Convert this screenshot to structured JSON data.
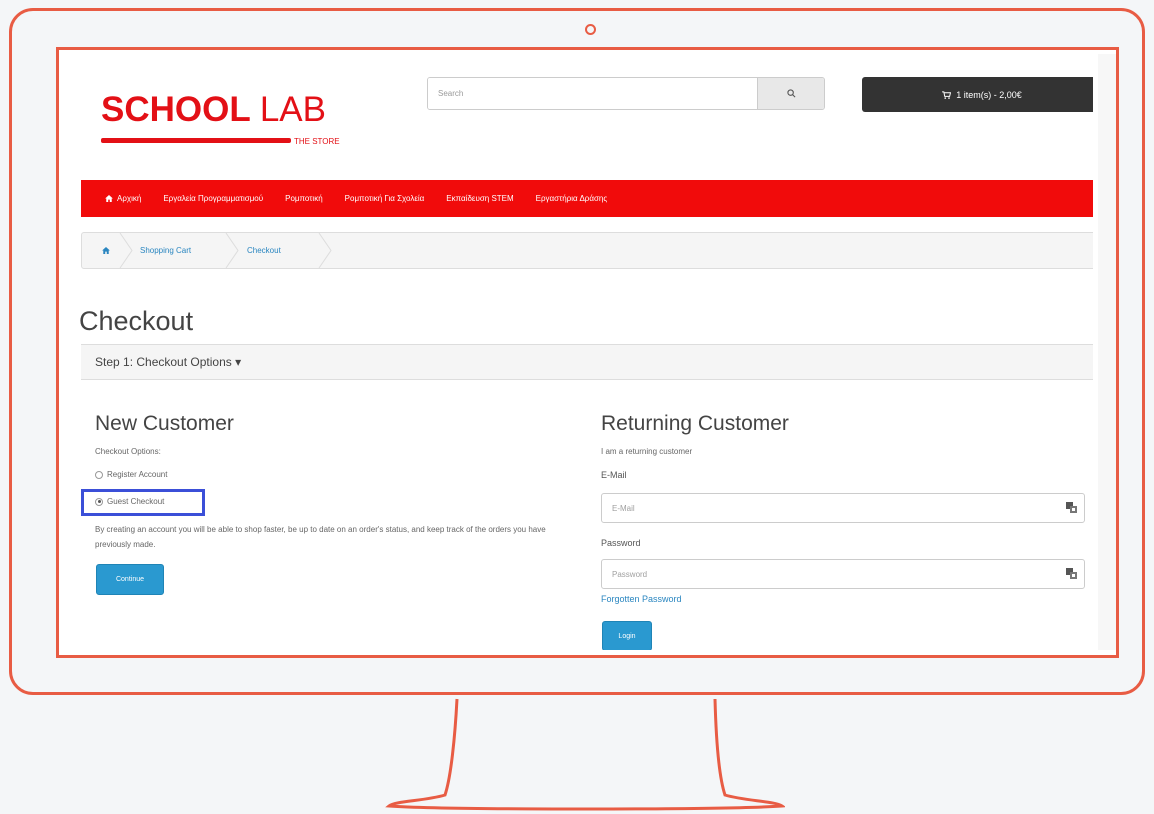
{
  "header": {
    "logo_bold": "SCHOOL",
    "logo_thin": "LAB",
    "logo_sub": "THE STORE",
    "search_placeholder": "Search",
    "cart_label": "1 item(s) - 2,00€"
  },
  "nav": {
    "items": [
      {
        "label": "Αρχική",
        "icon": "home-icon"
      },
      {
        "label": "Εργαλεία Προγραμματισμού"
      },
      {
        "label": "Ρομποτική"
      },
      {
        "label": "Ρομποτική Για Σχολεία"
      },
      {
        "label": "Εκπαίδευση STEM"
      },
      {
        "label": "Εργαστήρια Δράσης"
      }
    ]
  },
  "breadcrumb": {
    "home_icon": "home-icon",
    "items": [
      "Shopping Cart",
      "Checkout"
    ]
  },
  "page": {
    "title": "Checkout",
    "step_heading": "Step 1: Checkout Options",
    "step_caret": "▾"
  },
  "new_customer": {
    "heading": "New Customer",
    "options_label": "Checkout Options:",
    "register_label": "Register Account",
    "guest_label": "Guest Checkout",
    "selected": "guest",
    "description": "By creating an account you will be able to shop faster, be up to date on an order's status, and keep track of the orders you have previously made.",
    "continue_button": "Continue"
  },
  "returning_customer": {
    "heading": "Returning Customer",
    "intro": "I am a returning customer",
    "email_label": "E-Mail",
    "email_placeholder": "E-Mail",
    "password_label": "Password",
    "password_placeholder": "Password",
    "forgotten_link": "Forgotten Password",
    "login_button": "Login"
  },
  "colors": {
    "brand_red": "#e31016",
    "nav_red": "#f10b0b",
    "button_blue": "#2a99d0",
    "monitor_outline": "#e85c44",
    "highlight_blue": "#3b4fd8"
  }
}
